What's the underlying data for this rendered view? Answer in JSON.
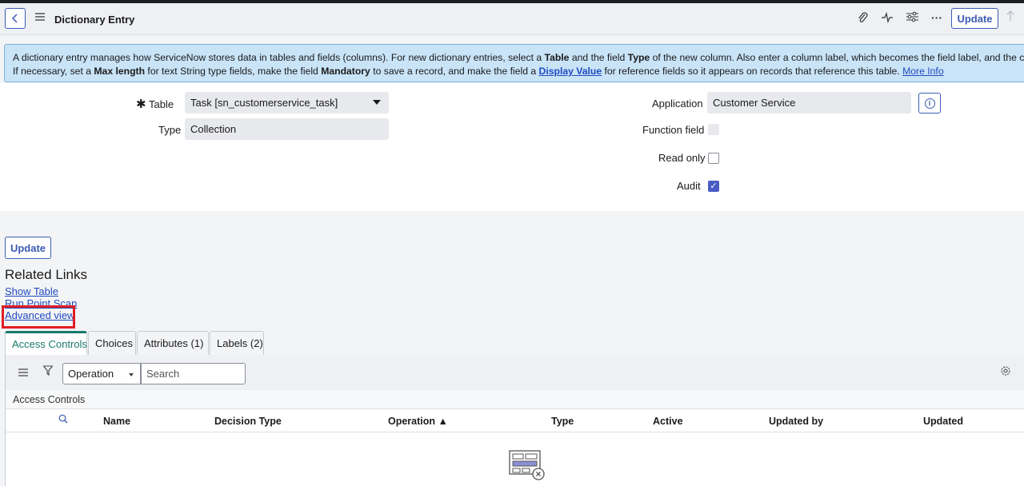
{
  "header": {
    "title": "Dictionary Entry",
    "update_label": "Update",
    "icons": [
      "back-icon",
      "menu-icon",
      "paperclip-icon",
      "activity-icon",
      "sliders-icon",
      "more-icon",
      "arrow-up-icon"
    ]
  },
  "banner": {
    "line1_a": "A dictionary entry manages how ServiceNow stores data in tables and fields (columns). For new dictionary entries, select a ",
    "line1_table": "Table",
    "line1_b": " and the field ",
    "line1_type": "Type",
    "line1_c": " of the new column. Also enter a column label, which becomes the field label, and the column na",
    "line2_a": "If necessary, set a ",
    "line2_maxlen": "Max length",
    "line2_b": " for text String type fields, make the field ",
    "line2_mandatory": "Mandatory",
    "line2_c": " to save a record, and make the field a ",
    "line2_display": "Display Value",
    "line2_d": " for reference fields so it appears on records that reference this table. ",
    "line2_more": "More Info"
  },
  "form": {
    "table_label": "Table",
    "table_value": "Task [sn_customerservice_task]",
    "type_label": "Type",
    "type_value": "Collection",
    "application_label": "Application",
    "application_value": "Customer Service",
    "function_field_label": "Function field",
    "read_only_label": "Read only",
    "audit_label": "Audit",
    "audit_checked": true,
    "read_only_checked": false,
    "function_field_checked": false
  },
  "actions": {
    "update_label": "Update"
  },
  "related_links": {
    "heading": "Related Links",
    "items": [
      "Show Table",
      "Run Point Scan",
      "Advanced view"
    ]
  },
  "tabs": [
    "Access Controls",
    "Choices",
    "Attributes (1)",
    "Labels (2)"
  ],
  "list": {
    "select_value": "Operation",
    "search_placeholder": "Search",
    "section_label": "Access Controls",
    "columns": [
      "Name",
      "Decision Type",
      "Operation ▲",
      "Type",
      "Active",
      "Updated by",
      "Updated"
    ]
  },
  "colors": {
    "accent": "#3c5bb5",
    "tab_active": "#1a7a6a",
    "highlight": "#e11d24",
    "banner_bg": "#c9e3f7"
  }
}
